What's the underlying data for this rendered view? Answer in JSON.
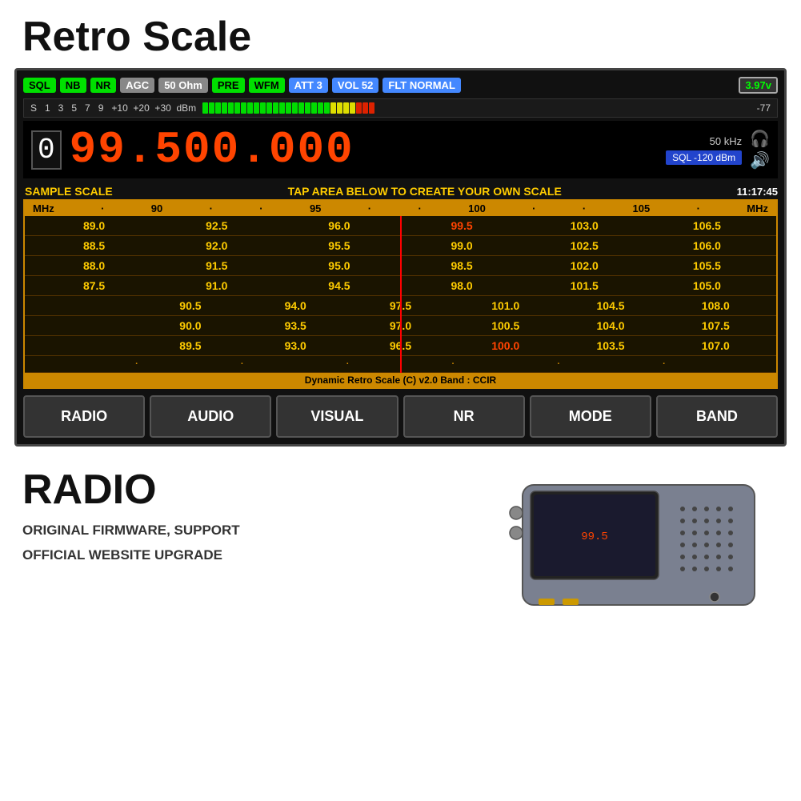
{
  "page": {
    "title": "Retro Scale",
    "bg_color": "#ffffff"
  },
  "status_bar": {
    "badges": [
      {
        "label": "SQL",
        "style": "badge-green"
      },
      {
        "label": "NB",
        "style": "badge-green"
      },
      {
        "label": "NR",
        "style": "badge-green"
      },
      {
        "label": "AGC",
        "style": "badge-gray"
      },
      {
        "label": "50 Ohm",
        "style": "badge-gray"
      },
      {
        "label": "PRE",
        "style": "badge-green"
      },
      {
        "label": "WFM",
        "style": "badge-green"
      },
      {
        "label": "ATT 3",
        "style": "badge-blue"
      },
      {
        "label": "VOL 52",
        "style": "badge-blue"
      },
      {
        "label": "FLT NORMAL",
        "style": "badge-blue"
      }
    ],
    "battery": "3.97v"
  },
  "signal_meter": {
    "scale_labels": "S   1   3   5   7   9   +10  +20  +30  dBm",
    "dbm_value": "-77",
    "green_count": 20,
    "yellow_count": 5,
    "red_count": 3
  },
  "frequency": {
    "digit_small": "0",
    "main": "99.500.000",
    "khz": "50 kHz",
    "sql_label": "SQL -120 dBm"
  },
  "scale_section": {
    "sample_label": "SAMPLE SCALE",
    "tap_label": "TAP AREA BELOW TO CREATE YOUR OWN SCALE",
    "time": "11:17:45",
    "top_rule": [
      "MHz",
      "·",
      "90",
      "·",
      "·",
      "95",
      "·",
      "·",
      "100",
      "·",
      "·",
      "105",
      "·",
      "MHz"
    ],
    "rows": [
      [
        "89.0",
        "92.5",
        "96.0",
        "99.5",
        "103.0",
        "106.5"
      ],
      [
        "88.5",
        "92.0",
        "95.5",
        "99.0",
        "102.5",
        "106.0"
      ],
      [
        "88.0",
        "91.5",
        "95.0",
        "98.5",
        "102.0",
        "105.5"
      ],
      [
        "87.5",
        "91.0",
        "94.5",
        "98.0",
        "101.5",
        "105.0"
      ],
      [
        "",
        "90.5",
        "94.0",
        "97.5",
        "101.0",
        "104.5",
        "108.0"
      ],
      [
        "",
        "90.0",
        "93.5",
        "97.0",
        "100.5",
        "104.0",
        "107.5"
      ],
      [
        "",
        "89.5",
        "93.0",
        "96.5",
        "100.0",
        "103.5",
        "107.0"
      ]
    ],
    "active_values": [
      "99.5",
      "100.0"
    ],
    "footer": "Dynamic Retro Scale (C) v2.0 Band : CCIR"
  },
  "nav_buttons": [
    "RADIO",
    "AUDIO",
    "VISUAL",
    "NR",
    "MODE",
    "BAND"
  ],
  "lower": {
    "radio_label": "RADIO",
    "line1": "ORIGINAL FIRMWARE, SUPPORT",
    "line2": "OFFICIAL WEBSITE UPGRADE"
  }
}
